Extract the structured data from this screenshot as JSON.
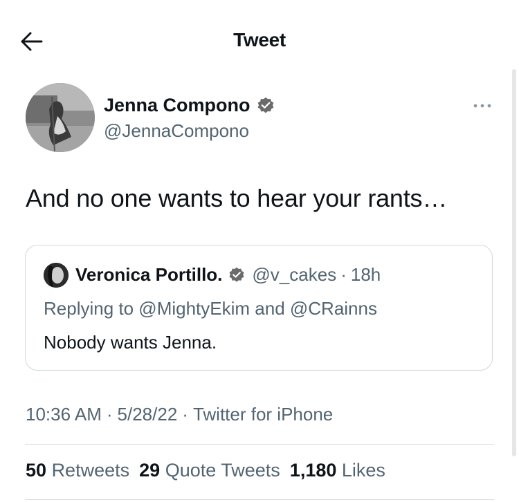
{
  "header": {
    "title": "Tweet",
    "back_icon": "arrow-left-icon"
  },
  "author": {
    "name": "Jenna Compono",
    "handle": "@JennaCompono",
    "verified_icon": "verified-badge-icon",
    "more_icon": "more-horizontal-icon"
  },
  "tweet": {
    "text": "And no one wants to hear your rants…"
  },
  "quote": {
    "name": "Veronica Portillo.",
    "handle": "@v_cakes",
    "separator": "·",
    "time": "18h",
    "replying_to": "Replying to @MightyEkim and @CRainns",
    "text": "Nobody wants Jenna."
  },
  "meta": {
    "time": "10:36 AM",
    "date": "5/28/22",
    "source": "Twitter for iPhone",
    "separator": "·"
  },
  "stats": {
    "retweets_count": "50",
    "retweets_label": "Retweets",
    "quotes_count": "29",
    "quotes_label": "Quote Tweets",
    "likes_count": "1,180",
    "likes_label": "Likes"
  },
  "colors": {
    "text": "#0f1419",
    "secondary": "#536471",
    "border": "#cfd9de"
  }
}
